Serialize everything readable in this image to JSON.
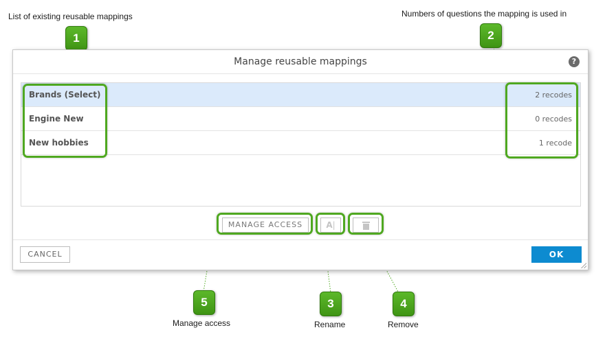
{
  "annotations": {
    "list_label": "List of existing reusable mappings",
    "numbers_label": "Numbers of questions the mapping is used in",
    "manage_label": "Manage access",
    "rename_label": "Rename",
    "remove_label": "Remove",
    "badges": [
      "1",
      "2",
      "3",
      "4",
      "5"
    ],
    "accent_color": "#4fa820"
  },
  "dialog": {
    "title": "Manage reusable mappings",
    "help_icon": "?",
    "mappings": [
      {
        "name": "Brands (Select)",
        "usage": "2 recodes",
        "selected": true
      },
      {
        "name": "Engine New",
        "usage": "0 recodes",
        "selected": false
      },
      {
        "name": "New hobbies",
        "usage": "1 recode",
        "selected": false
      }
    ],
    "manage_access_label": "MANAGE ACCESS",
    "rename_icon": "A",
    "cancel_label": "CANCEL",
    "ok_label": "OK",
    "ok_color": "#0d8bd0",
    "selected_row_color": "#dbeafb"
  }
}
